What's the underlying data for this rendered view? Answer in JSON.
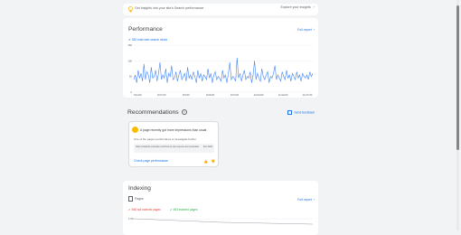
{
  "banner": {
    "message": "Get insights into your site's Search performance",
    "explore_label": "Explore your insights"
  },
  "performance": {
    "title": "Performance",
    "full_report": "Full report",
    "legend": "330 total web search clicks",
    "y_ticks": [
      "150",
      "100",
      "50",
      "0"
    ],
    "x_ticks": [
      "7/31/20",
      "8/17/20",
      "9/3/20",
      "9/20/20",
      "10/7/20",
      "10/24/20",
      "11/10/20",
      "11/27/20"
    ],
    "line_color": "#4285f4",
    "clicks": [
      40,
      55,
      30,
      70,
      45,
      60,
      35,
      90,
      40,
      65,
      55,
      30,
      80,
      45,
      50,
      70,
      35,
      60,
      95,
      40,
      55,
      45,
      75,
      30,
      60,
      50,
      85,
      40,
      45,
      65,
      35,
      55,
      70,
      40,
      50,
      60,
      35,
      80,
      45,
      55,
      40,
      65,
      50,
      30,
      70,
      45,
      60,
      35,
      55,
      50,
      40,
      75,
      45,
      60,
      30,
      55,
      65,
      40,
      50,
      45,
      35,
      70,
      45,
      55,
      30,
      60,
      95,
      40,
      50,
      45,
      35,
      110,
      45,
      60,
      35,
      55,
      70,
      40,
      50,
      45,
      65,
      30,
      55,
      100,
      40,
      60,
      45,
      35,
      75,
      50,
      40,
      55,
      65,
      30,
      50,
      45,
      60,
      85,
      40,
      55,
      45,
      35,
      65,
      50,
      40,
      70,
      45,
      55,
      35,
      60,
      50,
      40,
      65,
      45,
      55,
      35,
      60,
      50,
      45,
      55,
      40,
      65,
      50,
      60
    ]
  },
  "recommendations": {
    "title": "Recommendations",
    "info_icon": "info-icon",
    "send_feedback": "Send feedback",
    "card": {
      "title": "A page recently got more impressions than usual",
      "description": "One of the page's performance is investigate further",
      "url": "https://sitelinks.example.com/how-to-win-request-ai-in-a-landed-pet-flat-mode-loaders-that-hinder",
      "date": "Dec 2023",
      "action": "Check page performance"
    }
  },
  "indexing": {
    "title": "Indexing",
    "full_report": "Full report",
    "pages_label": "Pages",
    "not_indexed": "948 not indexed pages",
    "indexed": "493 indexed pages",
    "y_tick": "1.5K"
  }
}
